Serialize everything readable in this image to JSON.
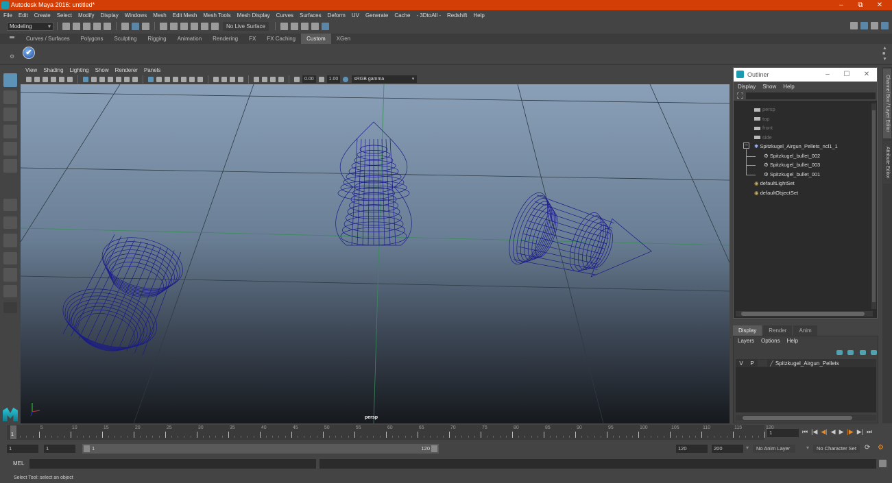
{
  "window": {
    "title": "Autodesk Maya 2016: untitled*",
    "controls": {
      "minimize": "–",
      "maximize": "⧉",
      "close": "✕"
    }
  },
  "menubar": [
    "File",
    "Edit",
    "Create",
    "Select",
    "Modify",
    "Display",
    "Windows",
    "Mesh",
    "Edit Mesh",
    "Mesh Tools",
    "Mesh Display",
    "Curves",
    "Surfaces",
    "Deform",
    "UV",
    "Generate",
    "Cache",
    "- 3DtoAll -",
    "Redshift",
    "Help"
  ],
  "toolbar": {
    "mode": "Modeling",
    "live_surface": "No Live Surface"
  },
  "shelf_tabs": [
    {
      "label": "Curves / Surfaces",
      "active": false
    },
    {
      "label": "Polygons",
      "active": false
    },
    {
      "label": "Sculpting",
      "active": false
    },
    {
      "label": "Rigging",
      "active": false
    },
    {
      "label": "Animation",
      "active": false
    },
    {
      "label": "Rendering",
      "active": false
    },
    {
      "label": "FX",
      "active": false
    },
    {
      "label": "FX Caching",
      "active": false
    },
    {
      "label": "Custom",
      "active": true
    },
    {
      "label": "XGen",
      "active": false
    }
  ],
  "shelf": {
    "icon": "check-icon",
    "glyph": "✔"
  },
  "left_tools": [
    "select-tool",
    "lasso-tool",
    "paint-select-tool",
    "move-tool",
    "rotate-tool",
    "scale-tool"
  ],
  "viewport": {
    "menu": [
      "View",
      "Shading",
      "Lighting",
      "Show",
      "Renderer",
      "Panels"
    ],
    "exposure": "0.00",
    "gamma": "1.00",
    "color_space": "sRGB gamma",
    "camera_label": "persp",
    "wire_color": "#1a1a8a",
    "axis_labels": {
      "y": "y",
      "x": "x",
      "z": "z"
    }
  },
  "outliner": {
    "title": "Outliner",
    "menu": [
      "Display",
      "Show",
      "Help"
    ],
    "items": [
      {
        "label": "persp",
        "type": "camera",
        "dim": true
      },
      {
        "label": "top",
        "type": "camera",
        "dim": true
      },
      {
        "label": "front",
        "type": "camera",
        "dim": true
      },
      {
        "label": "side",
        "type": "camera",
        "dim": true
      },
      {
        "label": "Spitzkugel_Airgun_Pellets_ncl1_1",
        "type": "group",
        "expanded": true
      },
      {
        "label": "Spitzkugel_bullet_002",
        "type": "mesh",
        "child": true
      },
      {
        "label": "Spitzkugel_bullet_003",
        "type": "mesh",
        "child": true
      },
      {
        "label": "Spitzkugel_bullet_001",
        "type": "mesh",
        "child": true
      },
      {
        "label": "defaultLightSet",
        "type": "set"
      },
      {
        "label": "defaultObjectSet",
        "type": "set"
      }
    ]
  },
  "side_tabs": [
    "Channel Box / Layer Editor",
    "Attribute Editor"
  ],
  "layer_editor": {
    "tabs": [
      {
        "label": "Display",
        "active": true
      },
      {
        "label": "Render",
        "active": false
      },
      {
        "label": "Anim",
        "active": false
      }
    ],
    "menu": [
      "Layers",
      "Options",
      "Help"
    ],
    "layers": [
      {
        "v": "V",
        "p": "P",
        "name": "Spitzkugel_Airgun_Pellets"
      }
    ]
  },
  "timeline": {
    "ticks": [
      5,
      10,
      15,
      20,
      25,
      30,
      35,
      40,
      45,
      50,
      55,
      60,
      65,
      70,
      75,
      80,
      85,
      90,
      95,
      100,
      105,
      110,
      115,
      120
    ],
    "current_frame": "1",
    "current_frame_field": "1"
  },
  "range": {
    "start_field": "1",
    "playback_start": "1",
    "range_start_label": "1",
    "range_end_label": "120",
    "playback_end": "120",
    "end_field": "200",
    "anim_layer": "No Anim Layer",
    "character_set": "No Character Set"
  },
  "playback_buttons": [
    "⏮",
    "|◀",
    "◀|",
    "◀",
    "▶",
    "|▶",
    "▶|",
    "⏭"
  ],
  "mel": {
    "label": "MEL"
  },
  "status": "Select Tool: select an object"
}
